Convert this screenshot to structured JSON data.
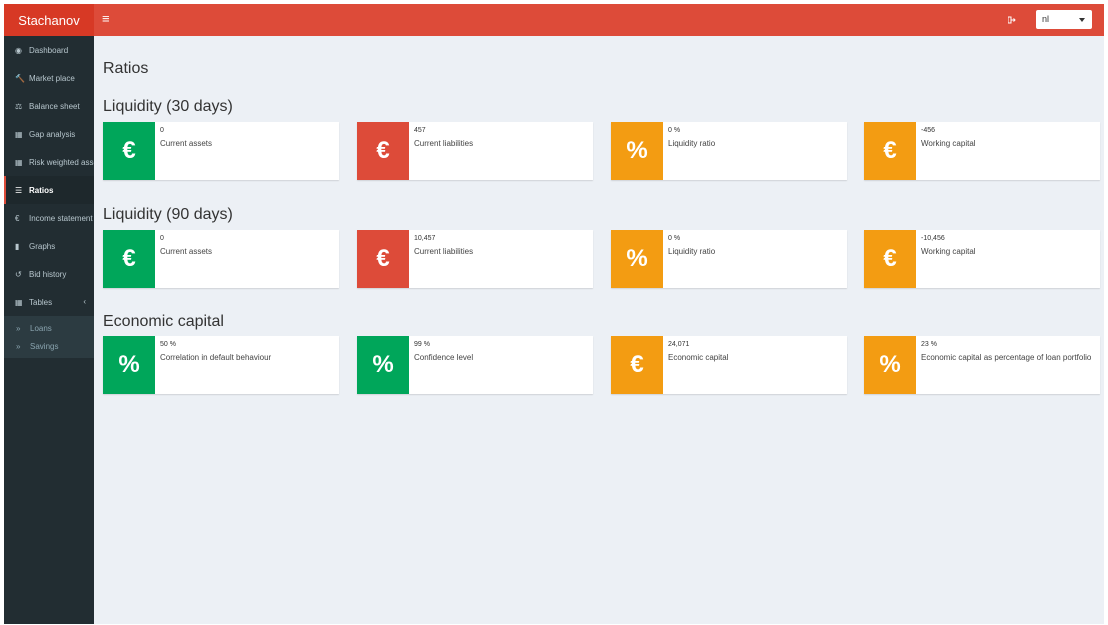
{
  "header": {
    "logo": "Stachanov",
    "toggle_icon": "≡",
    "language": "nl"
  },
  "colors": {
    "header": "#dd4b39",
    "logo_bg": "#d73925",
    "sidebar": "#222d32",
    "green": "#00a65a",
    "red": "#dd4b39",
    "orange": "#f39c12"
  },
  "sidebar": {
    "items": [
      {
        "label": "Dashboard",
        "icon": "dashboard-icon",
        "glyph": "◉"
      },
      {
        "label": "Market place",
        "icon": "gavel-icon",
        "glyph": "🔨"
      },
      {
        "label": "Balance sheet",
        "icon": "balance-scale-icon",
        "glyph": "⚖"
      },
      {
        "label": "Gap analysis",
        "icon": "table-icon",
        "glyph": "▦"
      },
      {
        "label": "Risk weighted assets",
        "icon": "table-icon",
        "glyph": "▦"
      },
      {
        "label": "Ratios",
        "icon": "list-icon",
        "glyph": "☰"
      },
      {
        "label": "Income statement",
        "icon": "euro-icon",
        "glyph": "€"
      },
      {
        "label": "Graphs",
        "icon": "bar-chart-icon",
        "glyph": "▮"
      },
      {
        "label": "Bid history",
        "icon": "history-icon",
        "glyph": "↺"
      },
      {
        "label": "Tables",
        "icon": "table-icon",
        "glyph": "▦"
      }
    ],
    "tables_chevron": "‹",
    "sub_items": [
      {
        "label": "Loans",
        "icon": "angle-double-right-icon",
        "glyph": "»"
      },
      {
        "label": "Savings",
        "icon": "angle-double-right-icon",
        "glyph": "»"
      }
    ]
  },
  "main": {
    "title": "Ratios",
    "sections": [
      {
        "title": "Liquidity (30 days)",
        "boxes": [
          {
            "value": "0",
            "label": "Current assets",
            "glyph": "€",
            "icon": "euro-icon",
            "color": "green"
          },
          {
            "value": "457",
            "label": "Current liabilities",
            "glyph": "€",
            "icon": "euro-icon",
            "color": "red"
          },
          {
            "value": "0 %",
            "label": "Liquidity ratio",
            "glyph": "%",
            "icon": "percent-icon",
            "color": "orange"
          },
          {
            "value": "-456",
            "label": "Working capital",
            "glyph": "€",
            "icon": "euro-icon",
            "color": "orange"
          }
        ]
      },
      {
        "title": "Liquidity (90 days)",
        "boxes": [
          {
            "value": "0",
            "label": "Current assets",
            "glyph": "€",
            "icon": "euro-icon",
            "color": "green"
          },
          {
            "value": "10,457",
            "label": "Current liabilities",
            "glyph": "€",
            "icon": "euro-icon",
            "color": "red"
          },
          {
            "value": "0 %",
            "label": "Liquidity ratio",
            "glyph": "%",
            "icon": "percent-icon",
            "color": "orange"
          },
          {
            "value": "-10,456",
            "label": "Working capital",
            "glyph": "€",
            "icon": "euro-icon",
            "color": "orange"
          }
        ]
      },
      {
        "title": "Economic capital",
        "boxes": [
          {
            "value": "50 %",
            "label": "Correlation in default behaviour",
            "glyph": "%",
            "icon": "percent-icon",
            "color": "green"
          },
          {
            "value": "99 %",
            "label": "Confidence level",
            "glyph": "%",
            "icon": "percent-icon",
            "color": "green"
          },
          {
            "value": "24,071",
            "label": "Economic capital",
            "glyph": "€",
            "icon": "euro-icon",
            "color": "orange"
          },
          {
            "value": "23 %",
            "label": "Economic capital as percentage of loan portfolio",
            "glyph": "%",
            "icon": "percent-icon",
            "color": "orange"
          }
        ]
      }
    ]
  }
}
